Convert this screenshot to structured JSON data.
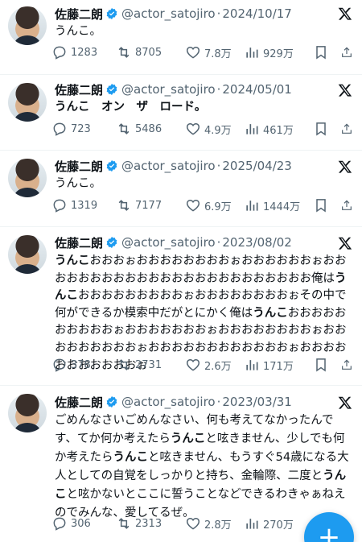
{
  "accent_color": "#1d9bf0",
  "verified_color": "#1d9bf0",
  "tweets": [
    {
      "name": "佐藤二朗",
      "handle": "@actor_satojiro",
      "dot": "·",
      "date": "2024/10/17",
      "text_segments": [
        {
          "t": "うんこ。",
          "b": false
        }
      ],
      "replies": "1283",
      "retweets": "8705",
      "likes": "7.8万",
      "views": "929万"
    },
    {
      "name": "佐藤二朗",
      "handle": "@actor_satojiro",
      "dot": "·",
      "date": "2024/05/01",
      "text_segments": [
        {
          "t": "うんこ　オン　ザ　ロード。",
          "b": true
        }
      ],
      "replies": "723",
      "retweets": "5486",
      "likes": "4.9万",
      "views": "461万"
    },
    {
      "name": "佐藤二朗",
      "handle": "@actor_satojiro",
      "dot": "·",
      "date": "2025/04/23",
      "text_segments": [
        {
          "t": "うんこ。",
          "b": false
        }
      ],
      "replies": "1319",
      "retweets": "7177",
      "likes": "6.9万",
      "views": "1444万"
    },
    {
      "name": "佐藤二朗",
      "handle": "@actor_satojiro",
      "dot": "·",
      "date": "2023/08/02",
      "text_segments": [
        {
          "t": "うんこ",
          "b": true
        },
        {
          "t": "おおおぉおおおおおおおおぉおおおおおおぉおおおおおおおおおおおおおおおおおおおおおおおお俺は",
          "b": false
        },
        {
          "t": "うんこ",
          "b": true
        },
        {
          "t": "おおおおおおおおおぉおおおおおおおおぉその中で何ができるか模索中だがとにかく俺は",
          "b": false
        },
        {
          "t": "うんこ",
          "b": true
        },
        {
          "t": "おおおおおおおおおおぉおおおおおおおぉおおおおおおおおぉおおおおおおおおおぉおおおおおおおおおおおおぉおおおおおおおおおおおぉ",
          "b": false
        }
      ],
      "replies": "378",
      "retweets": "2731",
      "likes": "2.6万",
      "views": "171万"
    },
    {
      "name": "佐藤二朗",
      "handle": "@actor_satojiro",
      "dot": "·",
      "date": "2023/03/31",
      "text_segments": [
        {
          "t": "ごめんなさいごめんなさい、何も考えてなかったんです、てか何か考えたら",
          "b": false
        },
        {
          "t": "うんこ",
          "b": true
        },
        {
          "t": "と呟きません、少しでも何か考えたら",
          "b": false
        },
        {
          "t": "うんこ",
          "b": true
        },
        {
          "t": "と呟きません、もうすぐ54歳になる大人としての自覚をしっかりと持ち、金輪際、二度と",
          "b": false
        },
        {
          "t": "うんこ",
          "b": true
        },
        {
          "t": "と呟かないとここに誓うことなどできるわきゃぁねえのでみんな、愛してるぜ。",
          "b": false
        }
      ],
      "replies": "306",
      "retweets": "2313",
      "likes": "2.8万",
      "views": "270万"
    }
  ],
  "fab_label": "+"
}
